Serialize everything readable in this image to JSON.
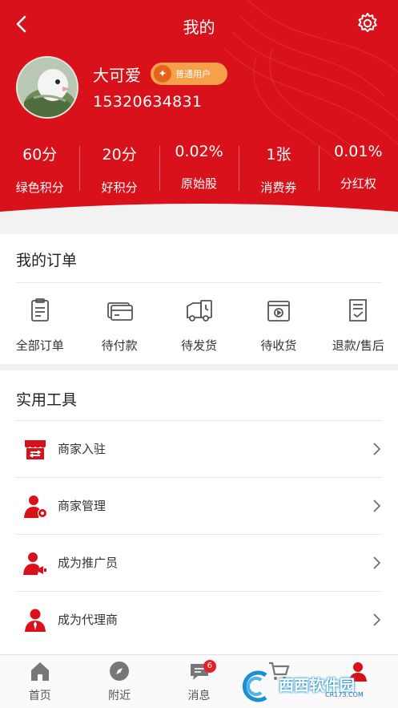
{
  "header": {
    "title": "我的",
    "user": {
      "name": "大可爱",
      "badge": "普通用户",
      "phone": "15320634831"
    },
    "stats": [
      {
        "value": "60分",
        "label": "绿色积分"
      },
      {
        "value": "20分",
        "label": "好积分"
      },
      {
        "value": "0.02%",
        "label": "原始股"
      },
      {
        "value": "1张",
        "label": "消费券"
      },
      {
        "value": "0.01%",
        "label": "分红权"
      }
    ]
  },
  "orders": {
    "title": "我的订单",
    "items": [
      {
        "label": "全部订单",
        "icon": "order-list-icon"
      },
      {
        "label": "待付款",
        "icon": "wallet-card-icon"
      },
      {
        "label": "待发货",
        "icon": "delivery-truck-icon"
      },
      {
        "label": "待收货",
        "icon": "package-box-icon"
      },
      {
        "label": "退款/售后",
        "icon": "refund-document-icon"
      }
    ]
  },
  "tools": {
    "title": "实用工具",
    "items": [
      {
        "label": "商家入驻",
        "icon": "storefront-icon"
      },
      {
        "label": "商家管理",
        "icon": "user-gear-icon"
      },
      {
        "label": "成为推广员",
        "icon": "user-megaphone-icon"
      },
      {
        "label": "成为代理商",
        "icon": "user-tie-icon"
      }
    ]
  },
  "tabbar": {
    "items": [
      {
        "label": "首页",
        "icon": "home-icon"
      },
      {
        "label": "附近",
        "icon": "compass-icon"
      },
      {
        "label": "消息",
        "icon": "chat-bubble-icon",
        "badge": "6"
      },
      {
        "label": "",
        "icon": "cart-icon"
      },
      {
        "label": "",
        "icon": "profile-icon"
      }
    ]
  },
  "watermark": {
    "text": "西西软件园",
    "url": "CR173.COM"
  },
  "colors": {
    "brand_red": "#d8111a",
    "badge_orange": "#f6a04a",
    "page_bg": "#f2f2f2"
  }
}
